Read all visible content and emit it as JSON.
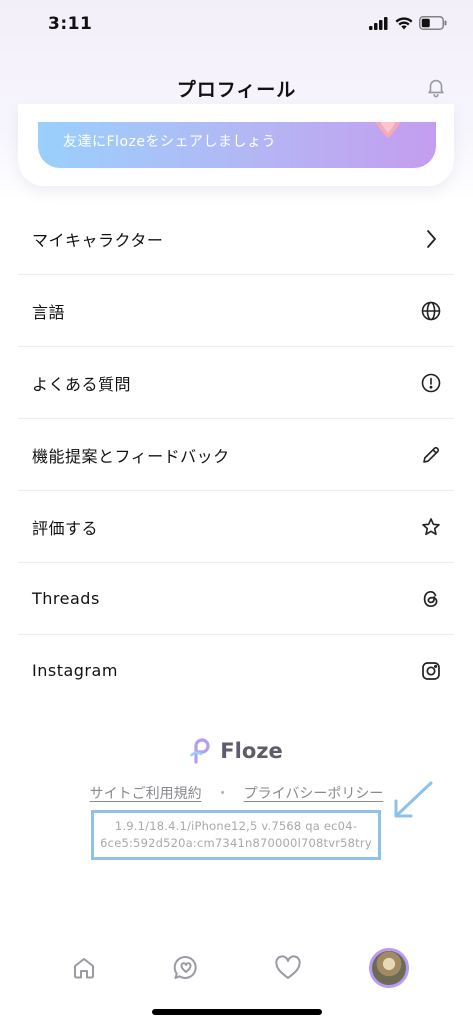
{
  "status_bar": {
    "time": "3:11"
  },
  "header": {
    "title": "プロフィール"
  },
  "share_banner": {
    "text": "友達にFlozeをシェアしましょう"
  },
  "menu": {
    "items": [
      {
        "label": "マイキャラクター",
        "icon": "chevron-right-icon"
      },
      {
        "label": "言語",
        "icon": "globe-icon"
      },
      {
        "label": "よくある質問",
        "icon": "alert-circle-icon"
      },
      {
        "label": "機能提案とフィードバック",
        "icon": "pencil-icon"
      },
      {
        "label": "評価する",
        "icon": "star-icon"
      },
      {
        "label": "Threads",
        "icon": "threads-icon"
      },
      {
        "label": "Instagram",
        "icon": "instagram-icon"
      }
    ]
  },
  "footer": {
    "brand": "Floze",
    "terms_link": "サイトご利用規約",
    "separator": "・",
    "privacy_link": "プライバシーポリシー",
    "version_line1": "1.9.1/18.4.1/iPhone12,5 v.7568 qa ec04-",
    "version_line2": "6ce5:592d520a:cm7341n870000l708tvr58try"
  },
  "tab_bar": {
    "tabs": [
      "home-icon",
      "chat-heart-icon",
      "heart-icon",
      "avatar"
    ]
  },
  "colors": {
    "accent": "#b69cf2",
    "banner_start": "#9ad0fb",
    "banner_end": "#c49df0",
    "highlight_box": "#8fc2ea"
  }
}
